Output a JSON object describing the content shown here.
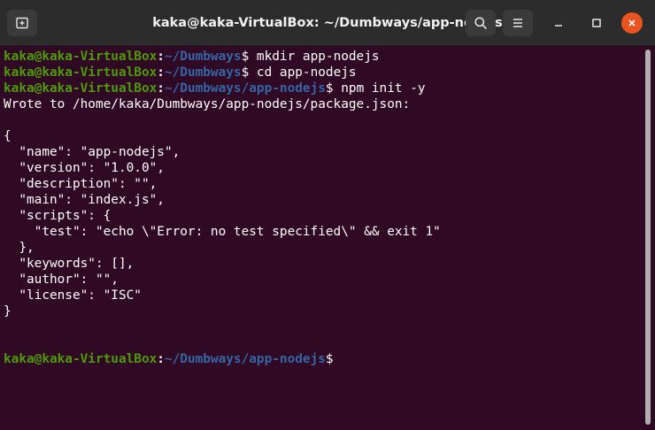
{
  "window": {
    "title": "kaka@kaka-VirtualBox: ~/Dumbways/app-nodejs"
  },
  "colors": {
    "background": "#300a24",
    "titlebar": "#2c2c2c",
    "prompt_user": "#4e9a06",
    "prompt_path": "#3465a4",
    "close_button": "#e95420"
  },
  "icons": {
    "new_tab": "new-tab-icon",
    "search": "search-icon",
    "menu": "hamburger-menu-icon",
    "minimize": "minimize-icon",
    "maximize": "maximize-icon",
    "close": "close-icon"
  },
  "terminal": {
    "prompt_user_host": "kaka@kaka-VirtualBox",
    "prompt_sep": ":",
    "prompt_dollar": "$",
    "prompts": [
      {
        "path": "~/Dumbways",
        "command": " mkdir app-nodejs"
      },
      {
        "path": "~/Dumbways",
        "command": " cd app-nodejs"
      },
      {
        "path": "~/Dumbways/app-nodejs",
        "command": " npm init -y"
      }
    ],
    "output": [
      "Wrote to /home/kaka/Dumbways/app-nodejs/package.json:",
      "",
      "{",
      "  \"name\": \"app-nodejs\",",
      "  \"version\": \"1.0.0\",",
      "  \"description\": \"\",",
      "  \"main\": \"index.js\",",
      "  \"scripts\": {",
      "    \"test\": \"echo \\\"Error: no test specified\\\" && exit 1\"",
      "  },",
      "  \"keywords\": [],",
      "  \"author\": \"\",",
      "  \"license\": \"ISC\"",
      "}"
    ],
    "final_prompt": {
      "path": "~/Dumbways/app-nodejs",
      "command": ""
    }
  }
}
